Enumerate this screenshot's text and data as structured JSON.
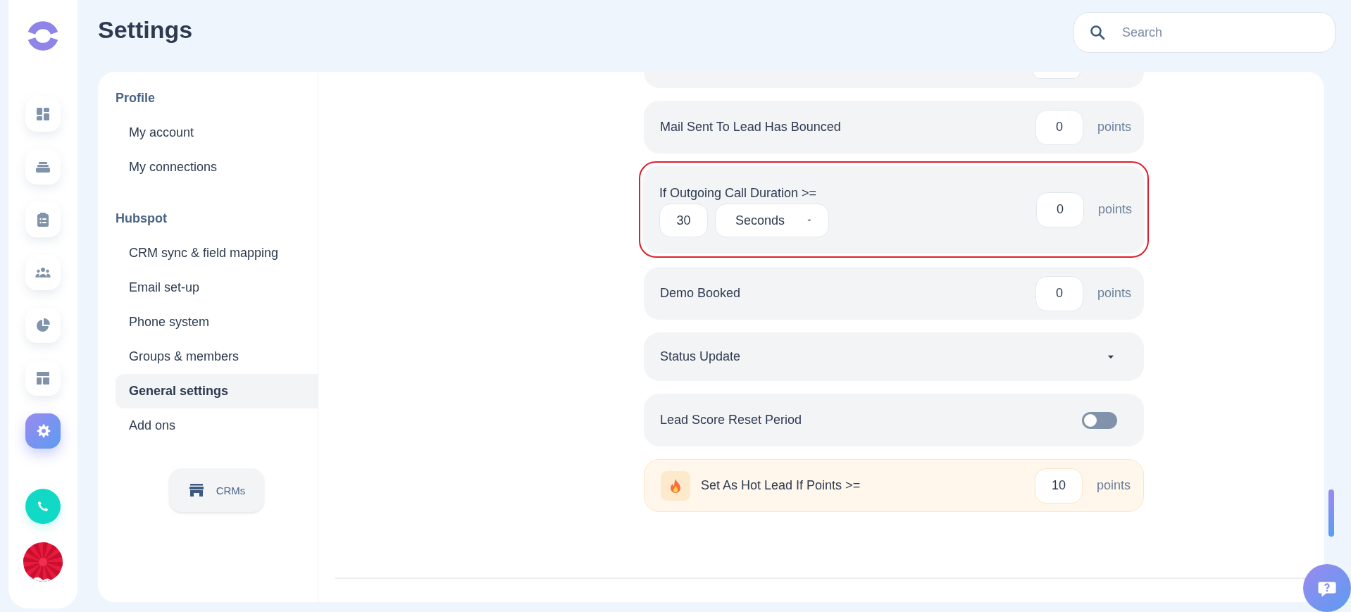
{
  "rail": [
    {
      "selected": false
    },
    {
      "selected": false
    },
    {
      "selected": false
    },
    {
      "selected": false
    },
    {
      "selected": false
    },
    {
      "selected": false
    },
    {
      "selected": true
    }
  ],
  "header": {
    "title": "Settings",
    "search": {
      "placeholder": "Search"
    }
  },
  "nav": {
    "sections": [
      {
        "heading": "Profile",
        "items": [
          {
            "label": "My account",
            "selected": false
          },
          {
            "label": "My connections",
            "selected": false
          }
        ]
      },
      {
        "heading": "Hubspot",
        "items": [
          {
            "label": "CRM sync & field mapping",
            "selected": false
          },
          {
            "label": "Email set-up",
            "selected": false
          },
          {
            "label": "Phone system",
            "selected": false
          },
          {
            "label": "Groups & members",
            "selected": false
          },
          {
            "label": "General settings",
            "selected": true
          },
          {
            "label": "Add ons",
            "selected": false
          }
        ]
      }
    ],
    "button": {
      "label": "CRMs"
    }
  },
  "rules": [
    {
      "kind": "partial",
      "highlighted": false
    },
    {
      "kind": "points",
      "highlighted": false,
      "label": "Mail Sent To Lead Has Bounced",
      "value": "0",
      "unit": "points"
    },
    {
      "kind": "duration",
      "highlighted": true,
      "label": "If Outgoing Call Duration >=",
      "amount": "30",
      "period": "Seconds",
      "value": "0",
      "unit": "points"
    },
    {
      "kind": "points",
      "highlighted": false,
      "label": "Demo Booked",
      "value": "0",
      "unit": "points"
    },
    {
      "kind": "dropdown",
      "highlighted": false,
      "label": "Status Update"
    },
    {
      "kind": "toggle",
      "highlighted": false,
      "label": "Lead Score Reset Period",
      "on": false
    },
    {
      "kind": "hot",
      "highlighted": false,
      "label": "Set As Hot Lead If Points >=",
      "value": "10",
      "unit": "points"
    }
  ]
}
